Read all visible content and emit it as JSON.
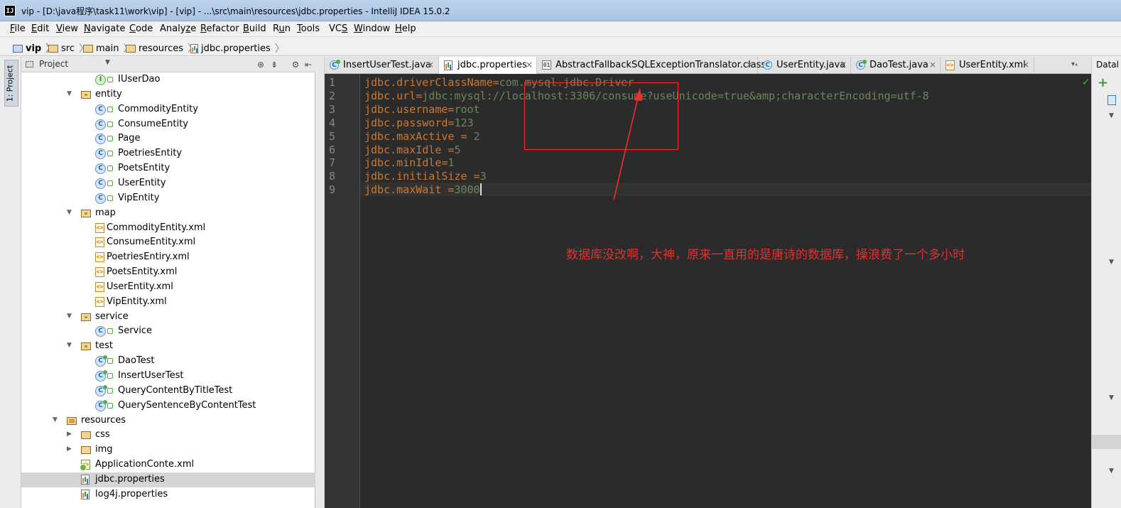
{
  "window": {
    "title": "vip - [D:\\java程序\\task11\\work\\vip] - [vip] - ...\\src\\main\\resources\\jdbc.properties - IntelliJ IDEA 15.0.2",
    "app_icon": "IJ"
  },
  "menu": [
    {
      "mn": "F",
      "rest": "ile"
    },
    {
      "mn": "E",
      "rest": "dit"
    },
    {
      "mn": "V",
      "rest": "iew"
    },
    {
      "mn": "N",
      "rest": "avigate"
    },
    {
      "mn": "C",
      "rest": "ode"
    },
    {
      "pre": "Analy",
      "mn": "z",
      "rest": "e"
    },
    {
      "mn": "R",
      "rest": "efactor"
    },
    {
      "mn": "B",
      "rest": "uild"
    },
    {
      "pre": "R",
      "mn": "u",
      "rest": "n"
    },
    {
      "mn": "T",
      "rest": "ools"
    },
    {
      "pre": "VC",
      "mn": "S",
      "rest": ""
    },
    {
      "mn": "W",
      "rest": "indow"
    },
    {
      "mn": "H",
      "rest": "elp"
    }
  ],
  "breadcrumb": [
    "vip",
    "src",
    "main",
    "resources",
    "jdbc.properties"
  ],
  "left_strip": {
    "label": "1: Project"
  },
  "project_panel": {
    "view_mode": "Project",
    "tree": [
      {
        "label": "IUserDao",
        "kind": "interface"
      },
      {
        "label": "entity",
        "kind": "package",
        "expanded": true
      },
      {
        "label": "CommodityEntity",
        "kind": "class"
      },
      {
        "label": "ConsumeEntity",
        "kind": "class"
      },
      {
        "label": "Page",
        "kind": "class"
      },
      {
        "label": "PoetriesEntity",
        "kind": "class"
      },
      {
        "label": "PoetsEntity",
        "kind": "class"
      },
      {
        "label": "UserEntity",
        "kind": "class"
      },
      {
        "label": "VipEntity",
        "kind": "class"
      },
      {
        "label": "map",
        "kind": "package",
        "expanded": true
      },
      {
        "label": "CommodityEntity.xml",
        "kind": "xml"
      },
      {
        "label": "ConsumeEntity.xml",
        "kind": "xml"
      },
      {
        "label": "PoetriesEntiry.xml",
        "kind": "xml"
      },
      {
        "label": "PoetsEntity.xml",
        "kind": "xml"
      },
      {
        "label": "UserEntity.xml",
        "kind": "xml"
      },
      {
        "label": "VipEntity.xml",
        "kind": "xml"
      },
      {
        "label": "service",
        "kind": "package",
        "expanded": true
      },
      {
        "label": "Service",
        "kind": "class"
      },
      {
        "label": "test",
        "kind": "package",
        "expanded": true
      },
      {
        "label": "DaoTest",
        "kind": "test"
      },
      {
        "label": "InsertUserTest",
        "kind": "test"
      },
      {
        "label": "QueryContentByTitleTest",
        "kind": "test"
      },
      {
        "label": "QuerySentenceByContentTest",
        "kind": "test"
      },
      {
        "label": "resources",
        "kind": "resources",
        "expanded": true
      },
      {
        "label": "css",
        "kind": "folder",
        "expanded": false
      },
      {
        "label": "img",
        "kind": "folder",
        "expanded": false
      },
      {
        "label": "ApplicationConte.xml",
        "kind": "spring-xml"
      },
      {
        "label": "jdbc.properties",
        "kind": "properties",
        "selected": true
      },
      {
        "label": "log4j.properties",
        "kind": "properties"
      }
    ]
  },
  "tabs": [
    {
      "label": "InsertUserTest.java",
      "icon": "test-class-icon",
      "close": "×"
    },
    {
      "label": "jdbc.properties",
      "icon": "properties-file-icon",
      "active": true,
      "close": "×"
    },
    {
      "label": "AbstractFallbackSQLExceptionTranslator.class",
      "icon": "class-file-icon",
      "close": "×"
    },
    {
      "label": "UserEntity.java",
      "icon": "class-icon",
      "close": "×"
    },
    {
      "label": "DaoTest.java",
      "icon": "test-class-icon",
      "close": "×"
    },
    {
      "label": "UserEntity.xml",
      "icon": "xml-file-icon",
      "close": "×"
    }
  ],
  "tabs_overflow": "▾₄",
  "editor": {
    "lines": [
      {
        "n": "1",
        "key": "jdbc.driverClassName",
        "sep": "=",
        "val": "com.mysql.jdbc.Driver"
      },
      {
        "n": "2",
        "key": "jdbc.url",
        "sep": "=",
        "val": "jdbc:mysql://localhost:3306/consume?useUnicode=true&amp;characterEncoding=utf-8"
      },
      {
        "n": "3",
        "key": "jdbc.username",
        "sep": "=",
        "val": "root"
      },
      {
        "n": "4",
        "key": "jdbc.password",
        "sep": "=",
        "val": "123"
      },
      {
        "n": "5",
        "key": "jdbc.maxActive",
        "sep": " = ",
        "val": "2"
      },
      {
        "n": "6",
        "key": "jdbc.maxIdle",
        "sep": " =",
        "val": "5"
      },
      {
        "n": "7",
        "key": "jdbc.minIdle",
        "sep": "=",
        "val": "1"
      },
      {
        "n": "8",
        "key": "jdbc.initialSize",
        "sep": " =",
        "val": "3"
      },
      {
        "n": "9",
        "key": "jdbc.maxWait",
        "sep": " =",
        "val": "3000"
      }
    ],
    "annotation": "数据库没改啊，大神，原来一直用的是唐诗的数据库，操浪费了一个多小时"
  },
  "right_strip": {
    "label": "Datal",
    "add": "+",
    "check": "✓"
  },
  "colors": {
    "editor_bg": "#2b2b2b",
    "key": "#cc7832",
    "value": "#6a8759",
    "annotation": "#e0312f"
  }
}
